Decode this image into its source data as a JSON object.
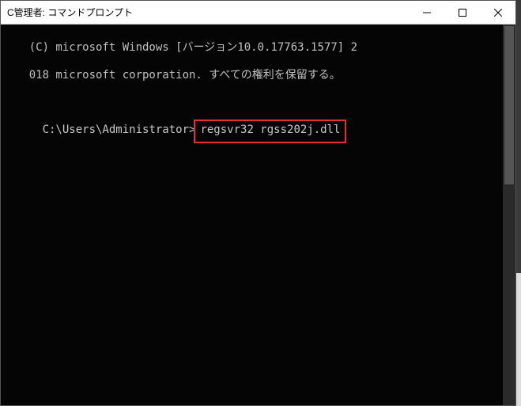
{
  "window": {
    "title": "C管理者:  コマンドプロンプト"
  },
  "terminal": {
    "copyright_line1": "(C) microsoft Windows [バージョン10.0.17763.1577] 2",
    "copyright_line2": "018 microsoft corporation. すべての権利を保留する。",
    "prompt": "C:\\Users\\Administrator>",
    "command": "regsvr32 rgss202j.dll"
  }
}
